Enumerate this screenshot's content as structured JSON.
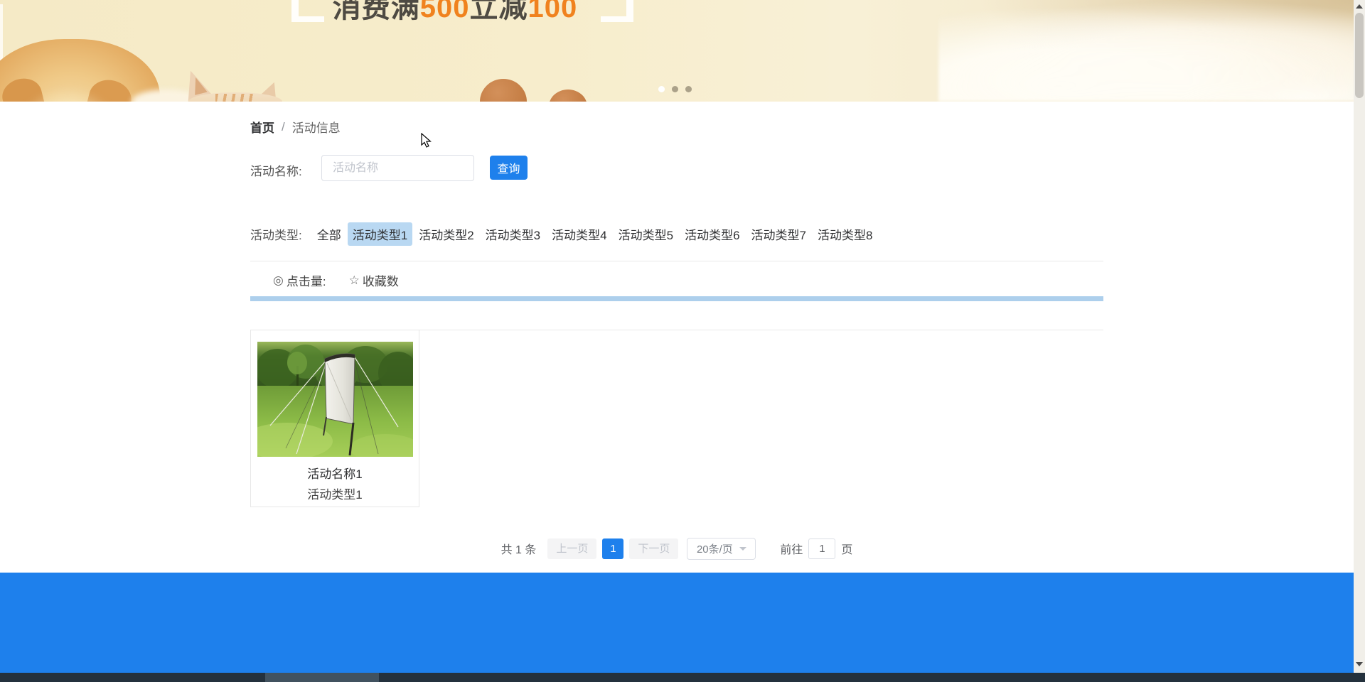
{
  "banner": {
    "promo": [
      {
        "text": "消费满",
        "color": "#4e4a42"
      },
      {
        "text": "500",
        "color": "#f0821e"
      },
      {
        "text": "立减",
        "color": "#4e4a42"
      },
      {
        "text": "100",
        "color": "#f0821e"
      }
    ],
    "carousel": {
      "dot_count": 3,
      "active_index": 0
    }
  },
  "breadcrumb": {
    "home": "首页",
    "separator": "/",
    "current": "活动信息"
  },
  "search": {
    "label": "活动名称:",
    "placeholder": "活动名称",
    "button_label": "查询"
  },
  "type_filter": {
    "label": "活动类型:",
    "options": [
      "全部",
      "活动类型1",
      "活动类型2",
      "活动类型3",
      "活动类型4",
      "活动类型5",
      "活动类型6",
      "活动类型7",
      "活动类型8"
    ],
    "active_option": "活动类型1"
  },
  "sort": {
    "click": {
      "icon": "eye-bullseye-icon",
      "glyph": "◎",
      "label": "点击量:"
    },
    "favorite": {
      "icon": "star-outline-icon",
      "glyph": "☆",
      "label": "收藏数"
    }
  },
  "cards": [
    {
      "title": "活动名称1",
      "type": "活动类型1",
      "image_desc": "projection-screen-in-green-field"
    }
  ],
  "pagination": {
    "total": "共 1 条",
    "prev_label": "上一页",
    "current_page": "1",
    "next_label": "下一页",
    "page_size": "20条/页",
    "goto_label": "前往",
    "goto_value": "1",
    "goto_unit": "页"
  },
  "colors": {
    "primary_blue": "#1e80ec",
    "footer_blue": "#1e80ec",
    "active_chip_bg": "#b9d8f2",
    "sort_bar_blue": "#adcfec",
    "banner_cream": "#f7edcc",
    "promo_orange": "#f0821e",
    "promo_dark": "#4e4a42"
  }
}
